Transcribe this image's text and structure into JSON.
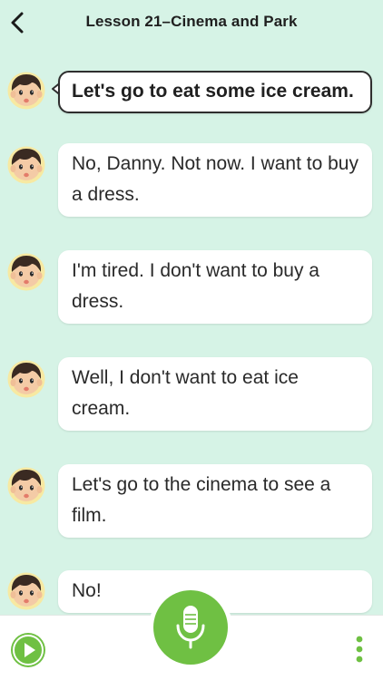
{
  "header": {
    "title": "Lesson 21–Cinema and Park",
    "back_icon": "chevron-left-icon"
  },
  "messages": [
    {
      "text": "Let's go to eat some ice cream.",
      "active": true
    },
    {
      "text": "No, Danny. Not now. I want to buy a dress.",
      "active": false
    },
    {
      "text": "I'm tired. I don't want to buy a dress.",
      "active": false
    },
    {
      "text": "Well, I don't want to eat ice cream.",
      "active": false
    },
    {
      "text": "Let's go to the cinema to see a film.",
      "active": false
    },
    {
      "text": "No!",
      "active": false
    }
  ],
  "bottom_bar": {
    "play_icon": "play-icon",
    "mic_icon": "microphone-icon",
    "more_icon": "more-vertical-icon"
  },
  "colors": {
    "background": "#d6f3e6",
    "accent_green": "#6fc043",
    "bubble": "#ffffff",
    "active_border": "#2e2e2e"
  }
}
